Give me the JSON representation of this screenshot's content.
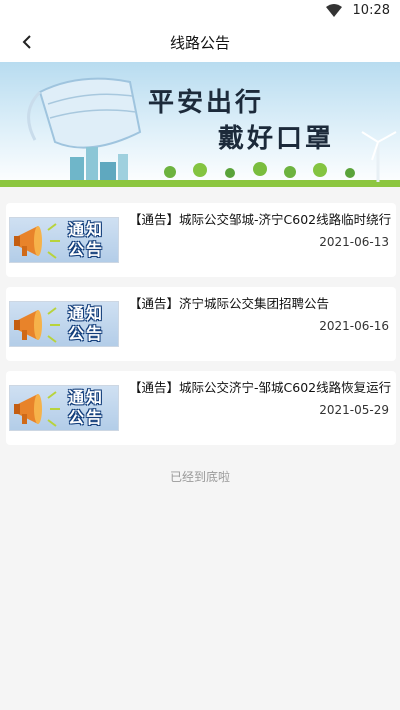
{
  "status_bar": {
    "time": "10:28"
  },
  "app_bar": {
    "title": "线路公告"
  },
  "banner": {
    "line1": "平安出行",
    "line2": "戴好口罩"
  },
  "thumbnail_label": "通知公告",
  "notices": [
    {
      "title": "【通告】城际公交邹城-济宁C602线路临时绕行",
      "date": "2021-06-13"
    },
    {
      "title": "【通告】济宁城际公交集团招聘公告",
      "date": "2021-06-16"
    },
    {
      "title": "【通告】城际公交济宁-邹城C602线路恢复运行",
      "date": "2021-05-29"
    }
  ],
  "list_end": "已经到底啦"
}
